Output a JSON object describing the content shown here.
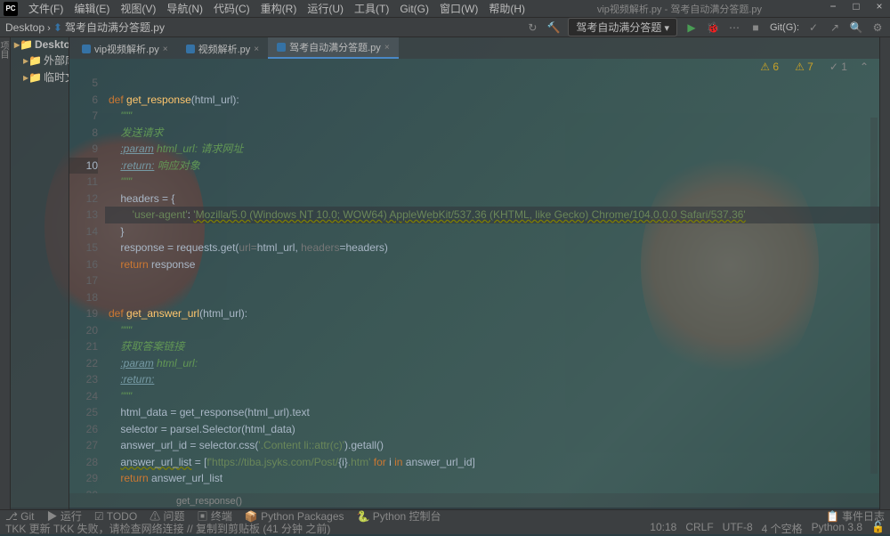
{
  "window": {
    "title": "vip视频解析.py - 驾考自动满分答题.py"
  },
  "menu": [
    "文件(F)",
    "编辑(E)",
    "视图(V)",
    "导航(N)",
    "代码(C)",
    "重构(R)",
    "运行(U)",
    "工具(T)",
    "Git(G)",
    "窗口(W)",
    "帮助(H)"
  ],
  "breadcrumb": {
    "root": "Desktop",
    "file": "驾考自动满分答题.py"
  },
  "run_config": "驾考自动满分答题",
  "git_label": "Git(G):",
  "tree": [
    {
      "label": "Desktop",
      "icon": "folder",
      "indent": 0,
      "bold": true
    },
    {
      "label": "外部库",
      "icon": "lib",
      "indent": 1
    },
    {
      "label": "临时文件和…",
      "icon": "scratch",
      "indent": 1
    }
  ],
  "tabs": [
    {
      "label": "vip视频解析.py",
      "active": false
    },
    {
      "label": "视频解析.py",
      "active": false
    },
    {
      "label": "驾考自动满分答题.py",
      "active": true
    }
  ],
  "inspection": {
    "errors": 6,
    "warnings": 7,
    "weak": 1
  },
  "lines": [
    {
      "n": 5,
      "html": ""
    },
    {
      "n": 6,
      "html": "<span class='kw'>def </span><span class='fn'>get_response</span>(html_url):"
    },
    {
      "n": 7,
      "html": "    <span class='doc'>\"\"\"</span>"
    },
    {
      "n": 8,
      "html": "    <span class='doc'>发送请求</span>"
    },
    {
      "n": 9,
      "html": "    <span class='docparam'>:param</span><span class='doc'> html_url: 请求网址</span>"
    },
    {
      "n": 10,
      "html": "    <span class='docparam'>:return:</span><span class='doc'> 响应对象</span>",
      "hl": true
    },
    {
      "n": 11,
      "html": "    <span class='doc'>\"\"\"</span>"
    },
    {
      "n": 12,
      "html": "    headers = {"
    },
    {
      "n": 13,
      "html": "        <span class='str'>'user-agent'</span>: <span class='str warn-u'>'Mozilla/5.0 (Windows NT 10.0; WOW64) AppleWebKit/537.36 (KHTML, like Gecko) Chrome/104.0.0.0 Safari/537.36'</span>",
      "hlbg": true
    },
    {
      "n": 14,
      "html": "    }"
    },
    {
      "n": 15,
      "html": "    response = requests.get(<span class='hint'>url=</span>html_url, <span class='hint'>headers</span>=headers)"
    },
    {
      "n": 16,
      "html": "    <span class='kw'>return</span> response"
    },
    {
      "n": 17,
      "html": ""
    },
    {
      "n": 18,
      "html": ""
    },
    {
      "n": 19,
      "html": "<span class='kw'>def </span><span class='fn'>get_answer_url</span>(html_url):"
    },
    {
      "n": 20,
      "html": "    <span class='doc'>\"\"\"</span>"
    },
    {
      "n": 21,
      "html": "    <span class='doc'>获取答案链接</span>"
    },
    {
      "n": 22,
      "html": "    <span class='docparam'>:param</span><span class='doc'> html_url:</span>"
    },
    {
      "n": 23,
      "html": "    <span class='docparam'>:return:</span>"
    },
    {
      "n": 24,
      "html": "    <span class='doc'>\"\"\"</span>"
    },
    {
      "n": 25,
      "html": "    html_data = get_response(html_url).text"
    },
    {
      "n": 26,
      "html": "    selector = parsel.Selector(html_data)"
    },
    {
      "n": 27,
      "html": "    answer_url_id = selector.css(<span class='str'>'.Content li::attr(c)'</span>).getall()"
    },
    {
      "n": 28,
      "html": "    <span class='warn-u'>answer_url_list</span> = [<span class='str'>f'https://tiba.jsyks.com/Post/</span>{i}<span class='str'>.htm'</span> <span class='kw'>for</span> i <span class='kw'>in</span> answer_url_id]"
    },
    {
      "n": 29,
      "html": "    <span class='kw'>return</span> answer_url_list"
    },
    {
      "n": 30,
      "html": ""
    }
  ],
  "breadcrumb_fn": "get_response()",
  "bottom": [
    "Git",
    "运行",
    "TODO",
    "问题",
    "终端",
    "Python Packages",
    "Python 控制台"
  ],
  "bottom_right": "事件日志",
  "status": {
    "msg": "TKK 更新 TKK 失败，请检查网络连接 // 复制到剪贴板 (41 分钟 之前)",
    "pos": "10:18",
    "crlf": "CRLF",
    "enc": "UTF-8",
    "indent": "4 个空格",
    "python": "Python 3.8"
  }
}
